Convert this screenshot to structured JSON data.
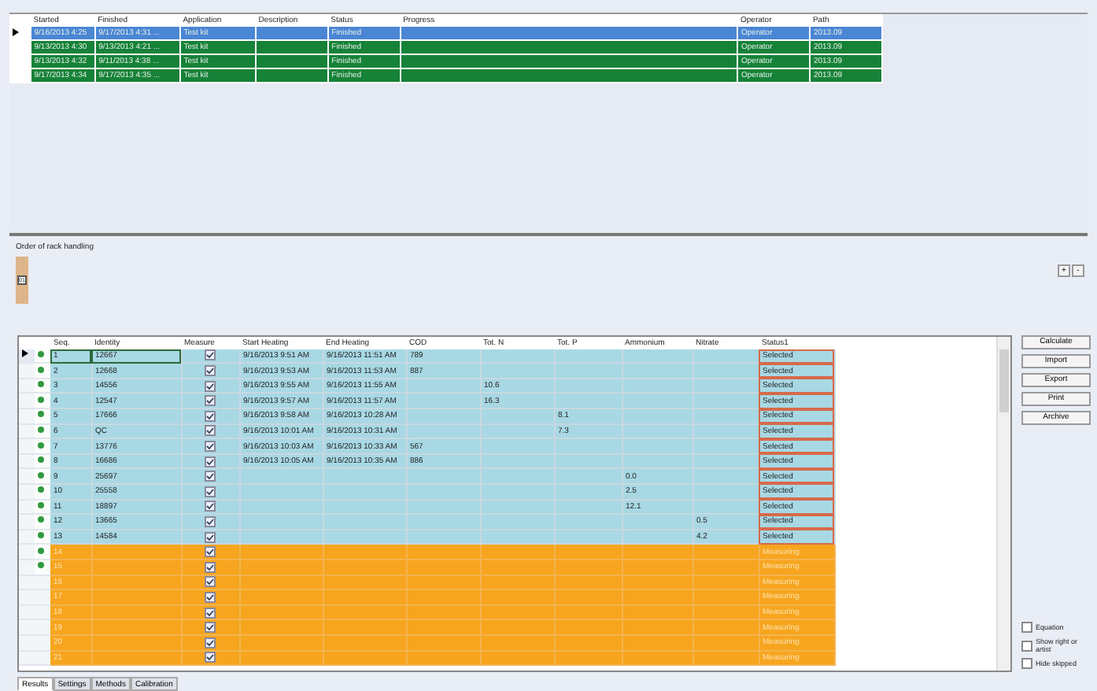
{
  "runs": {
    "columns": [
      "Started",
      "Finished",
      "Application",
      "Description",
      "Status",
      "Progress",
      "Operator",
      "Path"
    ],
    "rows": [
      {
        "selected": true,
        "cells": [
          "9/16/2013 4:25",
          "9/17/2013 4:31 ...",
          "Test kit",
          "",
          "Finished",
          "",
          "Operator",
          "2013.09"
        ]
      },
      {
        "selected": false,
        "cells": [
          "9/13/2013 4:30",
          "9/13/2013 4:21 ...",
          "Test kit",
          "",
          "Finished",
          "",
          "Operator",
          "2013.09"
        ]
      },
      {
        "selected": false,
        "cells": [
          "9/13/2013 4:32",
          "9/11/2013 4:38 ...",
          "Test kit",
          "",
          "Finished",
          "",
          "Operator",
          "2013.09"
        ]
      },
      {
        "selected": false,
        "cells": [
          "9/17/2013 4:34",
          "9/17/2013 4:35 ...",
          "Test kit",
          "",
          "Finished",
          "",
          "Operator",
          "2013.09"
        ]
      }
    ]
  },
  "rack": {
    "label": "Order of rack handling",
    "tile": "01",
    "buttons": [
      "+",
      "-"
    ]
  },
  "samples": {
    "columns": [
      "Seq.",
      "Identity",
      "Measure",
      "Start Heating",
      "End Heating",
      "COD",
      "Tot. N",
      "Tot. P",
      "Ammonium",
      "Nitrate",
      "Status1"
    ],
    "rows": [
      {
        "selected": true,
        "dot": true,
        "kind": "done",
        "measure": true,
        "cells": [
          "1",
          "12667",
          "",
          "9/16/2013 9:51 AM",
          "9/16/2013 11:51 AM",
          "789",
          "",
          "",
          "",
          "",
          "Selected"
        ]
      },
      {
        "selected": false,
        "dot": true,
        "kind": "done",
        "measure": true,
        "cells": [
          "2",
          "12668",
          "",
          "9/16/2013 9:53 AM",
          "9/16/2013 11:53 AM",
          "887",
          "",
          "",
          "",
          "",
          "Selected"
        ]
      },
      {
        "selected": false,
        "dot": true,
        "kind": "done",
        "measure": true,
        "cells": [
          "3",
          "14556",
          "",
          "9/16/2013 9:55 AM",
          "9/16/2013 11:55 AM",
          "",
          "10.6",
          "",
          "",
          "",
          "Selected"
        ]
      },
      {
        "selected": false,
        "dot": true,
        "kind": "done",
        "measure": true,
        "cells": [
          "4",
          "12547",
          "",
          "9/16/2013 9:57 AM",
          "9/16/2013 11:57 AM",
          "",
          "16.3",
          "",
          "",
          "",
          "Selected"
        ]
      },
      {
        "selected": false,
        "dot": true,
        "kind": "done",
        "measure": true,
        "cells": [
          "5",
          "17666",
          "",
          "9/16/2013 9:58 AM",
          "9/16/2013 10:28 AM",
          "",
          "",
          "8.1",
          "",
          "",
          "Selected"
        ]
      },
      {
        "selected": false,
        "dot": true,
        "kind": "done",
        "measure": true,
        "cells": [
          "6",
          "QC",
          "",
          "9/16/2013 10:01 AM",
          "9/16/2013 10:31 AM",
          "",
          "",
          "7.3",
          "",
          "",
          "Selected"
        ]
      },
      {
        "selected": false,
        "dot": true,
        "kind": "done",
        "measure": true,
        "cells": [
          "7",
          "13776",
          "",
          "9/16/2013 10:03 AM",
          "9/16/2013 10:33 AM",
          "567",
          "",
          "",
          "",
          "",
          "Selected"
        ]
      },
      {
        "selected": false,
        "dot": true,
        "kind": "done",
        "measure": true,
        "cells": [
          "8",
          "16686",
          "",
          "9/16/2013 10:05 AM",
          "9/16/2013 10:35 AM",
          "886",
          "",
          "",
          "",
          "",
          "Selected"
        ]
      },
      {
        "selected": false,
        "dot": true,
        "kind": "done",
        "measure": true,
        "cells": [
          "9",
          "25697",
          "",
          "",
          "",
          "",
          "",
          "",
          "0.0",
          "",
          "Selected"
        ]
      },
      {
        "selected": false,
        "dot": true,
        "kind": "done",
        "measure": true,
        "cells": [
          "10",
          "25558",
          "",
          "",
          "",
          "",
          "",
          "",
          "2.5",
          "",
          "Selected"
        ]
      },
      {
        "selected": false,
        "dot": true,
        "kind": "done",
        "measure": true,
        "cells": [
          "11",
          "18897",
          "",
          "",
          "",
          "",
          "",
          "",
          "12.1",
          "",
          "Selected"
        ]
      },
      {
        "selected": false,
        "dot": true,
        "kind": "done",
        "measure": true,
        "cells": [
          "12",
          "13665",
          "",
          "",
          "",
          "",
          "",
          "",
          "",
          "0.5",
          "Selected"
        ]
      },
      {
        "selected": false,
        "dot": true,
        "kind": "done",
        "measure": true,
        "cells": [
          "13",
          "14584",
          "",
          "",
          "",
          "",
          "",
          "",
          "",
          "4.2",
          "Selected"
        ]
      },
      {
        "selected": false,
        "dot": true,
        "kind": "measuring",
        "measure": true,
        "cells": [
          "14",
          "",
          "",
          "",
          "",
          "",
          "",
          "",
          "",
          "",
          "Measuring"
        ]
      },
      {
        "selected": false,
        "dot": true,
        "kind": "measuring",
        "measure": true,
        "cells": [
          "15",
          "",
          "",
          "",
          "",
          "",
          "",
          "",
          "",
          "",
          "Measuring"
        ]
      },
      {
        "selected": false,
        "dot": false,
        "kind": "measuring",
        "measure": true,
        "cells": [
          "16",
          "",
          "",
          "",
          "",
          "",
          "",
          "",
          "",
          "",
          "Measuring"
        ]
      },
      {
        "selected": false,
        "dot": false,
        "kind": "measuring",
        "measure": true,
        "cells": [
          "17",
          "",
          "",
          "",
          "",
          "",
          "",
          "",
          "",
          "",
          "Measuring"
        ]
      },
      {
        "selected": false,
        "dot": false,
        "kind": "measuring",
        "measure": true,
        "cells": [
          "18",
          "",
          "",
          "",
          "",
          "",
          "",
          "",
          "",
          "",
          "Measuring"
        ]
      },
      {
        "selected": false,
        "dot": false,
        "kind": "measuring",
        "measure": true,
        "cells": [
          "19",
          "",
          "",
          "",
          "",
          "",
          "",
          "",
          "",
          "",
          "Measuring"
        ]
      },
      {
        "selected": false,
        "dot": false,
        "kind": "measuring",
        "measure": true,
        "cells": [
          "20",
          "",
          "",
          "",
          "",
          "",
          "",
          "",
          "",
          "",
          "Measuring"
        ]
      },
      {
        "selected": false,
        "dot": false,
        "kind": "measuring",
        "measure": true,
        "cells": [
          "21",
          "",
          "",
          "",
          "",
          "",
          "",
          "",
          "",
          "",
          "Measuring"
        ]
      }
    ]
  },
  "actions": [
    "Calculate",
    "Import",
    "Export",
    "Print",
    "Archive"
  ],
  "options": [
    {
      "label": "Equation",
      "checked": false
    },
    {
      "label": "Show right or artist",
      "checked": false
    },
    {
      "label": "Hide skipped",
      "checked": false
    }
  ],
  "tabs": [
    {
      "label": "Results",
      "selected": true
    },
    {
      "label": "Settings",
      "selected": false
    },
    {
      "label": "Methods",
      "selected": false
    },
    {
      "label": "Calibration",
      "selected": false
    }
  ]
}
